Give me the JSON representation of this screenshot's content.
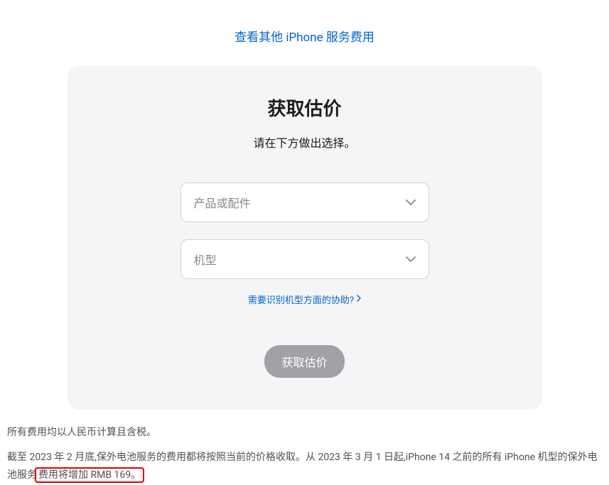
{
  "topLink": {
    "label": "查看其他 iPhone 服务费用"
  },
  "card": {
    "title": "获取估价",
    "subtitle": "请在下方做出选择。",
    "select1": {
      "placeholder": "产品或配件"
    },
    "select2": {
      "placeholder": "机型"
    },
    "helpLink": {
      "label": "需要识别机型方面的协助?"
    },
    "button": {
      "label": "获取估价"
    }
  },
  "footer": {
    "line1": "所有费用均以人民币计算且含税。",
    "line2_part1": "截至 2023 年 2 月底,保外电池服务的费用都将按照当前的价格收取。从 2023 年 3 月 1 日起,iPhone 14 之前的所有 iPhone 机型的保外电池服务",
    "line2_highlight": "费用将增加 RMB 169。"
  }
}
